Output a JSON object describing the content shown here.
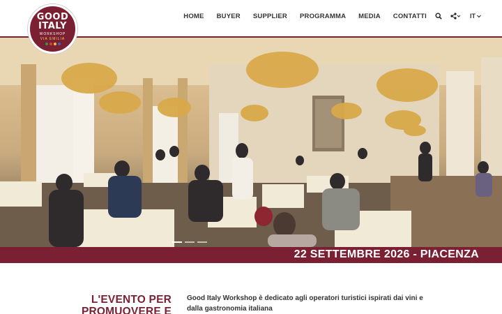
{
  "logo": {
    "line1": "GOOD",
    "line2": "ITALY",
    "line3": "WORKSHOP",
    "line4": "VIA EMILIA",
    "dot_colors": [
      "#2e9a4a",
      "#e03b3b",
      "#f2c230",
      "#2f6dc0"
    ]
  },
  "nav": {
    "items": [
      "HOME",
      "BUYER",
      "SUPPLIER",
      "PROGRAMMA",
      "MEDIA",
      "CONTATTI"
    ],
    "language": "IT"
  },
  "hero": {
    "image_icon": "ballroom-photo",
    "active_slide": 1,
    "slide_count": 3
  },
  "datebar": {
    "text": "22 SETTEMBRE 2026 - PIACENZA"
  },
  "event": {
    "title_line1": "L'EVENTO PER",
    "title_line2": "PROMUOVERE E",
    "intro": "Good Italy Workshop è dedicato agli operatori turistici ispirati dai vini e dalla gastronomia italiana"
  },
  "colors": {
    "brand": "#7b1f33",
    "accent": "#f4cf5a"
  }
}
